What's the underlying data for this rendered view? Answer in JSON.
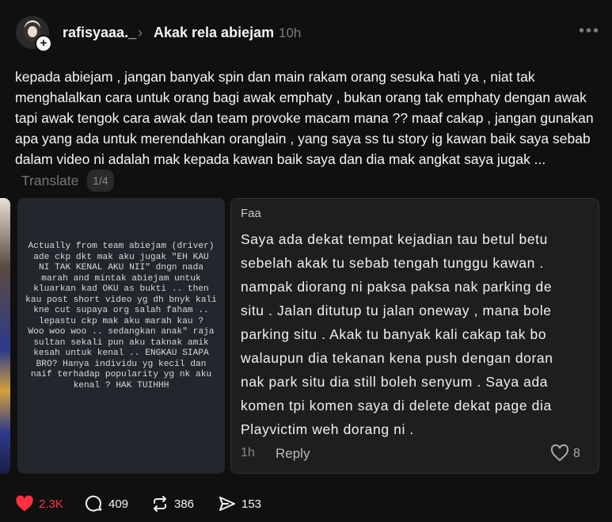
{
  "header": {
    "username": "rafisyaaa._",
    "separator_icon": "chevron-right-icon",
    "thread_title": "Akak rela abiejam",
    "time": "10h",
    "more_icon": "more-icon"
  },
  "post": {
    "text": "kepada abiejam , jangan banyak spin dan main rakam orang sesuka hati ya , niat tak menghalalkan cara untuk orang bagi awak emphaty , bukan orang tak emphaty dengan awak tapi awak tengok cara awak dan team provoke macam mana ?? maaf cakap , jangan gunakan apa yang ada untuk merendahkan oranglain , yang saya ss tu story ig kawan baik saya sebab dalam video ni adalah mak kepada kawan baik saya dan dia mak angkat saya jugak ...",
    "translate_label": "Translate",
    "page_indicator": "1/4"
  },
  "images": {
    "middle_text": "Actually from team abiejam (driver)\nade ckp dkt mak aku jugak \"EH KAU\nNI TAK KENAL AKU NII\" dngn nada\nmarah and mintak abiejam untuk\nkluarkan kad OKU as bukti .. then\nkau post short video yg dh bnyk kali\nkne cut supaya org salah faham ..\nlepastu ckp mak aku marah kau ?\nWoo woo woo .. sedangkan anak\" raja\nsultan sekali pun aku taknak amik\nkesah untuk kenal .. ENGKAU SIAPA\nBRO? Hanya individu yg kecil dan\nnaif terhadap popularity yg nk aku\nkenal ? HAK TUIHHH",
    "comment": {
      "author": "Faa",
      "text": "Saya ada dekat tempat kejadian tau betul betu\nsebelah akak tu sebab tengah tunggu kawan .\nnampak diorang ni paksa paksa nak parking de\nsitu . Jalan ditutup tu jalan oneway , mana bole\nparking situ . Akak tu banyak kali cakap tak bo\nwalaupun dia tekanan kena push dengan doran\nnak park situ dia still boleh senyum . Saya ada\nkomen tpi komen saya di delete dekat page dia\nPlayvictim weh dorang ni .",
      "time": "1h",
      "reply_label": "Reply",
      "likes": "8"
    }
  },
  "actions": {
    "likes": "2.3K",
    "comments": "409",
    "reposts": "386",
    "shares": "153"
  },
  "colors": {
    "background": "#101010",
    "like_red": "#ff3040",
    "muted": "#777777"
  }
}
